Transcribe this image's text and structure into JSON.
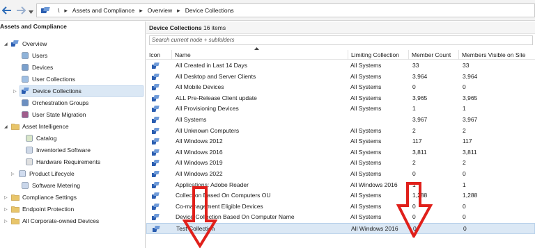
{
  "nav": {
    "back_icon": "arrow-left-icon",
    "forward_icon": "arrow-right-icon",
    "dropdown_icon": "chevron-down-icon"
  },
  "breadcrumb": {
    "root_sep": "\\",
    "items": [
      "Assets and Compliance",
      "Overview",
      "Device Collections"
    ],
    "separator": "▸"
  },
  "tree": {
    "title": "Assets and Compliance",
    "items": [
      {
        "label": "Overview",
        "icon": "overview-icon",
        "expander": "◢"
      },
      {
        "label": "Users",
        "icon": "users-icon"
      },
      {
        "label": "Devices",
        "icon": "devices-icon"
      },
      {
        "label": "User Collections",
        "icon": "user-collections-icon"
      },
      {
        "label": "Device Collections",
        "icon": "device-collections-icon",
        "expander": "▷"
      },
      {
        "label": "Orchestration Groups",
        "icon": "orchestration-groups-icon"
      },
      {
        "label": "User State Migration",
        "icon": "user-state-migration-icon"
      },
      {
        "label": "Asset Intelligence",
        "icon": "folder-icon",
        "expander": "◢"
      },
      {
        "label": "Catalog",
        "icon": "catalog-icon"
      },
      {
        "label": "Inventoried Software",
        "icon": "inventoried-software-icon"
      },
      {
        "label": "Hardware Requirements",
        "icon": "hardware-requirements-icon"
      },
      {
        "label": "Product Lifecycle",
        "icon": "product-lifecycle-icon",
        "expander": "▷"
      },
      {
        "label": "Software Metering",
        "icon": "software-metering-icon"
      },
      {
        "label": "Compliance Settings",
        "icon": "folder-icon",
        "expander": "▷"
      },
      {
        "label": "Endpoint Protection",
        "icon": "folder-icon",
        "expander": "▷"
      },
      {
        "label": "All Corporate-owned Devices",
        "icon": "folder-icon",
        "expander": "▷"
      }
    ]
  },
  "main": {
    "title": "Device Collections",
    "count": "16 items",
    "search_placeholder": "Search current node + subfolders",
    "columns": [
      "Icon",
      "Name",
      "Limiting Collection",
      "Member Count",
      "Members Visible on Site"
    ],
    "rows": [
      {
        "name": "All Created in Last 14 Days",
        "limiting": "All Systems",
        "members": "33",
        "visible": "33"
      },
      {
        "name": "All Desktop and Server Clients",
        "limiting": "All Systems",
        "members": "3,964",
        "visible": "3,964"
      },
      {
        "name": "All Mobile Devices",
        "limiting": "All Systems",
        "members": "0",
        "visible": "0"
      },
      {
        "name": "ALL Pre-Release Client update",
        "limiting": "All Systems",
        "members": "3,965",
        "visible": "3,965"
      },
      {
        "name": "All Provisioning Devices",
        "limiting": "All Systems",
        "members": "1",
        "visible": "1"
      },
      {
        "name": "All Systems",
        "limiting": "",
        "members": "3,967",
        "visible": "3,967"
      },
      {
        "name": "All Unknown Computers",
        "limiting": "All Systems",
        "members": "2",
        "visible": "2"
      },
      {
        "name": "All Windows 2012",
        "limiting": "All Systems",
        "members": "117",
        "visible": "117"
      },
      {
        "name": "All Windows 2016",
        "limiting": "All Systems",
        "members": "3,811",
        "visible": "3,811"
      },
      {
        "name": "All Windows 2019",
        "limiting": "All Systems",
        "members": "2",
        "visible": "2"
      },
      {
        "name": "All Windows 2022",
        "limiting": "All Systems",
        "members": "0",
        "visible": "0"
      },
      {
        "name": "Applications: Adobe Reader",
        "limiting": "All Windows 2016",
        "members": "1",
        "visible": "1"
      },
      {
        "name": "Collection Based On Computers OU",
        "limiting": "All Systems",
        "members": "1,288",
        "visible": "1,288"
      },
      {
        "name": "Co-management Eligible Devices",
        "limiting": "All Systems",
        "members": "0",
        "visible": "0"
      },
      {
        "name": "Device Collection Based On Computer Name",
        "limiting": "All Systems",
        "members": "0",
        "visible": "0"
      },
      {
        "name": "Test Collection",
        "limiting": "All Windows 2016",
        "members": "0",
        "visible": "0"
      }
    ]
  },
  "annotations": {
    "arrow_color": "#e0201b"
  }
}
